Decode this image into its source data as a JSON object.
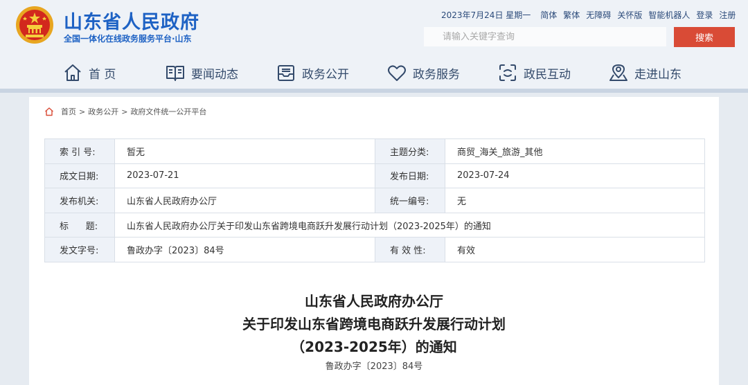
{
  "header": {
    "site_title": "山东省人民政府",
    "site_subtitle": "全国一体化在线政务服务平台·山东",
    "logo_icon": "national-emblem-icon"
  },
  "toplinks": {
    "date": "2023年7月24日 星期一",
    "simplified": "简体",
    "traditional": "繁体",
    "accessibility": "无障碍",
    "care": "关怀版",
    "robot": "智能机器人",
    "login": "登录",
    "register": "注册"
  },
  "search": {
    "placeholder": "请输入关键字查询",
    "button": "搜索"
  },
  "nav": [
    {
      "label": "首 页",
      "icon": "home-icon"
    },
    {
      "label": "要闻动态",
      "icon": "book-icon"
    },
    {
      "label": "政务公开",
      "icon": "inbox-icon"
    },
    {
      "label": "政务服务",
      "icon": "heart-icon"
    },
    {
      "label": "政民互动",
      "icon": "interaction-icon"
    },
    {
      "label": "走进山东",
      "icon": "location-icon"
    }
  ],
  "breadcrumb": [
    "首页",
    "政务公开",
    "政府文件统一公开平台"
  ],
  "breadcrumb_sep": ">",
  "meta": {
    "index_label": "索 引 号:",
    "index_value": "暂无",
    "topic_label": "主题分类:",
    "topic_value": "商贸_海关_旅游_其他",
    "created_label": "成文日期:",
    "created_value": "2023-07-21",
    "published_label": "发布日期:",
    "published_value": "2023-07-24",
    "issuer_label": "发布机关:",
    "issuer_value": "山东省人民政府办公厅",
    "serial_label": "统一编号:",
    "serial_value": "无",
    "title_label": "标      题:",
    "title_value": "山东省人民政府办公厅关于印发山东省跨境电商跃升发展行动计划（2023-2025年）的通知",
    "docno_label": "发文字号:",
    "docno_value": "鲁政办字〔2023〕84号",
    "validity_label": "有 效 性:",
    "validity_value": "有效"
  },
  "document": {
    "title_line1": "山东省人民政府办公厅",
    "title_line2": "关于印发山东省跨境电商跃升发展行动计划",
    "title_line3": "（2023-2025年）的通知",
    "number": "鲁政办字〔2023〕84号"
  },
  "colors": {
    "brand_blue": "#1e62c4",
    "search_red": "#d94b36",
    "nav_text": "#334a6b"
  }
}
